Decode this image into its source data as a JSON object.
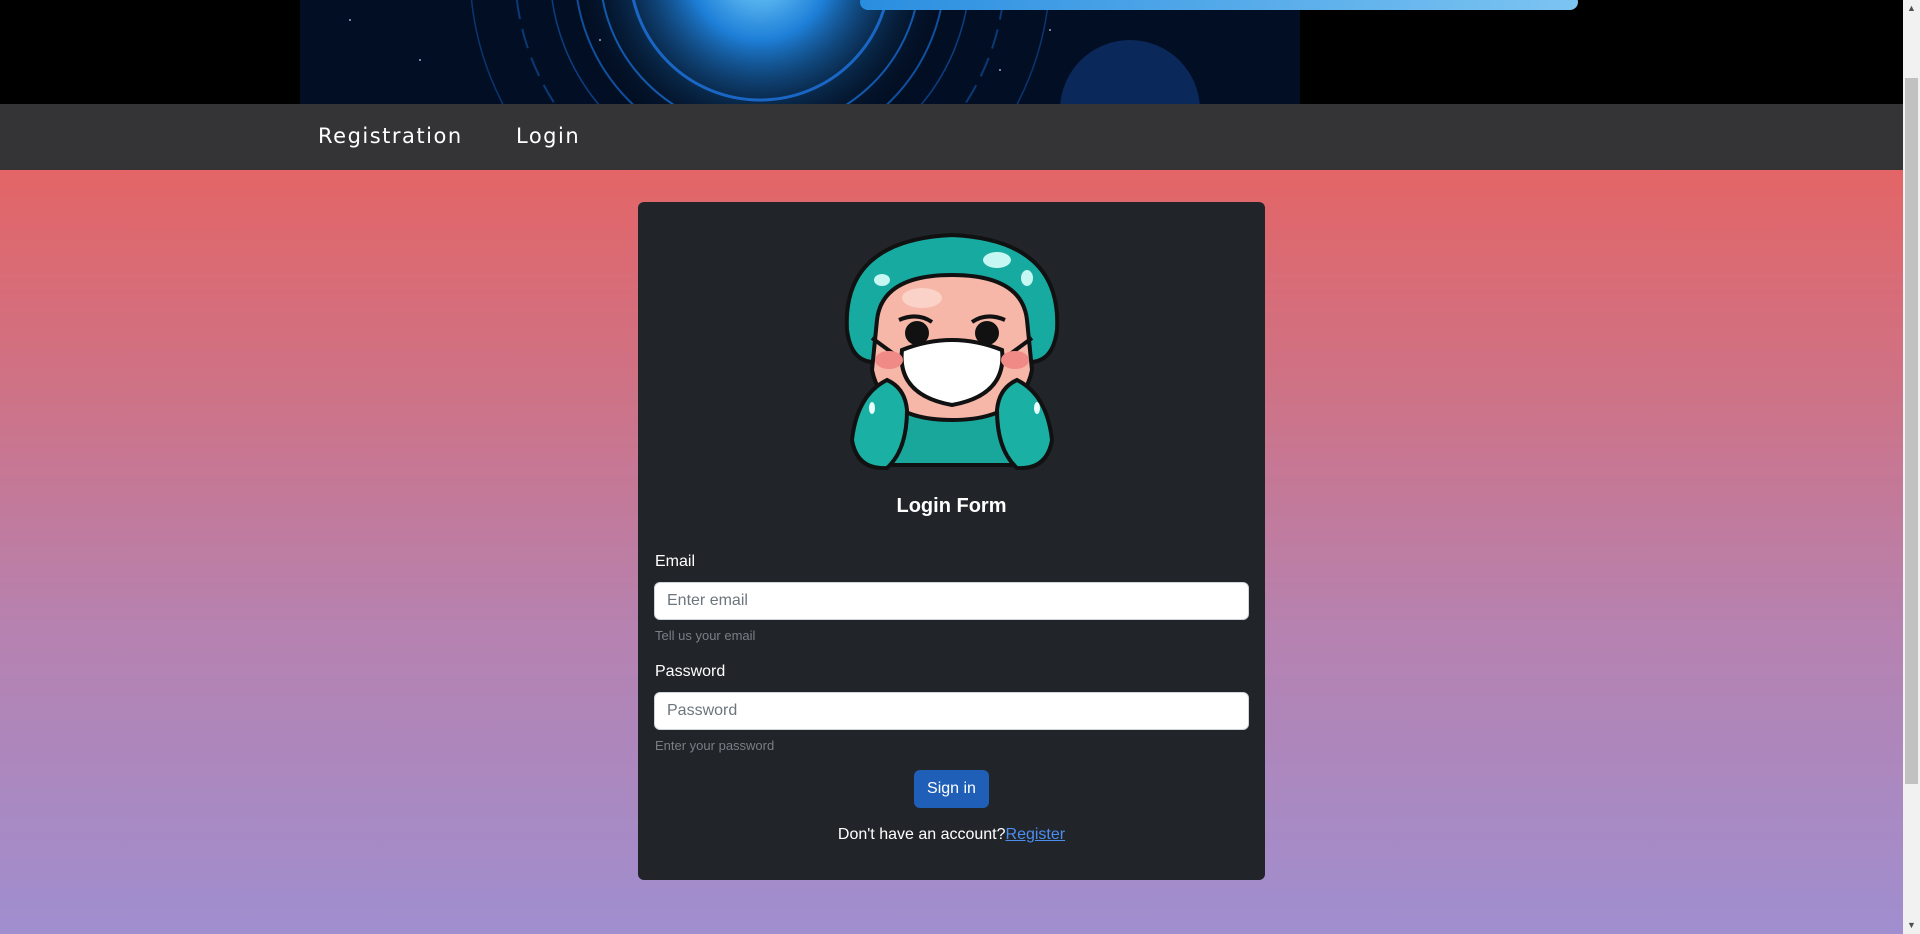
{
  "nav": {
    "registration_label": "Registration",
    "login_label": "Login"
  },
  "form": {
    "title": "Login Form",
    "email": {
      "label": "Email",
      "placeholder": "Enter email",
      "value": "",
      "help": "Tell us your email"
    },
    "password": {
      "label": "Password",
      "placeholder": "Password",
      "value": "",
      "help": "Enter your password"
    },
    "submit_label": "Sign in",
    "footer_text": "Don't have an account?",
    "register_link": "Register"
  },
  "colors": {
    "navbar": "#343436",
    "card": "#212429",
    "button": "#1f5fb8",
    "link": "#4c8df0",
    "gradient_top": "#e36566",
    "gradient_bottom": "#a08ecf"
  },
  "icons": {
    "avatar": "masked-doctor-avatar",
    "scroll_up": "triangle-up-icon",
    "scroll_down": "triangle-down-icon"
  }
}
